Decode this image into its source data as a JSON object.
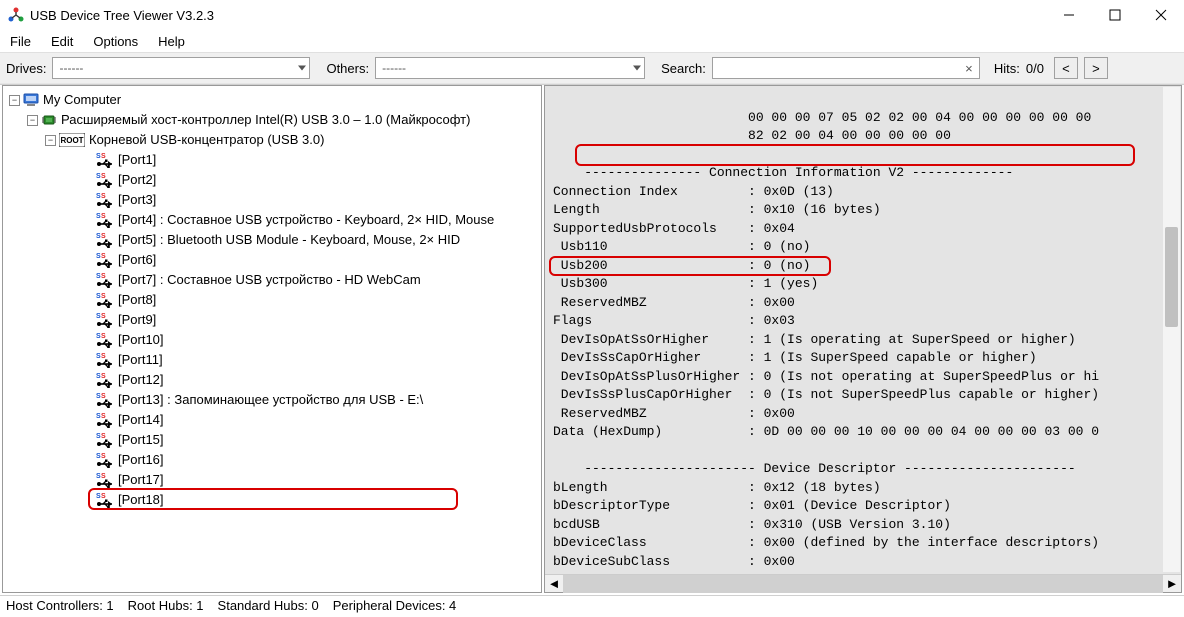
{
  "titlebar": {
    "title": "USB Device Tree Viewer V3.2.3"
  },
  "menu": {
    "file": "File",
    "edit": "Edit",
    "options": "Options",
    "help": "Help"
  },
  "toolbar": {
    "drives_label": "Drives:",
    "drives_value": "------",
    "others_label": "Others:",
    "others_value": "------",
    "search_label": "Search:",
    "hits_label": "Hits:",
    "hits_value": "0/0",
    "nav_prev": "<",
    "nav_next": ">",
    "clear_icon": "×"
  },
  "tree": {
    "root": "My Computer",
    "controller": "Расширяемый хост-контроллер Intel(R) USB 3.0 – 1.0 (Майкрософт)",
    "hub": "Корневой USB-концентратор (USB 3.0)",
    "root_badge": "ROOT",
    "ports": [
      {
        "label": "[Port1]",
        "desc": ""
      },
      {
        "label": "[Port2]",
        "desc": ""
      },
      {
        "label": "[Port3]",
        "desc": ""
      },
      {
        "label": "[Port4]",
        "desc": " : Составное USB устройство - Keyboard, 2× HID, Mouse"
      },
      {
        "label": "[Port5]",
        "desc": " : Bluetooth USB Module - Keyboard, Mouse, 2× HID"
      },
      {
        "label": "[Port6]",
        "desc": ""
      },
      {
        "label": "[Port7]",
        "desc": " : Составное USB устройство - HD WebCam"
      },
      {
        "label": "[Port8]",
        "desc": ""
      },
      {
        "label": "[Port9]",
        "desc": ""
      },
      {
        "label": "[Port10]",
        "desc": ""
      },
      {
        "label": "[Port11]",
        "desc": ""
      },
      {
        "label": "[Port12]",
        "desc": ""
      },
      {
        "label": "[Port13]",
        "desc": " : Запоминающее устройство для USB - E:\\"
      },
      {
        "label": "[Port14]",
        "desc": ""
      },
      {
        "label": "[Port15]",
        "desc": ""
      },
      {
        "label": "[Port16]",
        "desc": ""
      },
      {
        "label": "[Port17]",
        "desc": ""
      },
      {
        "label": "[Port18]",
        "desc": ""
      }
    ]
  },
  "details": {
    "l01": "                         00 00 00 07 05 02 02 00 04 00 00 00 00 00 00",
    "l02": "                         82 02 00 04 00 00 00 00 00",
    "l03": "",
    "l04": "    --------------- Connection Information V2 -------------",
    "l05": "Connection Index         : 0x0D (13)",
    "l06": "Length                   : 0x10 (16 bytes)",
    "l07": "SupportedUsbProtocols    : 0x04",
    "l08": " Usb110                  : 0 (no)",
    "l09": " Usb200                  : 0 (no)",
    "l10": " Usb300                  : 1 (yes)",
    "l11": " ReservedMBZ             : 0x00",
    "l12": "Flags                    : 0x03",
    "l13": " DevIsOpAtSsOrHigher     : 1 (Is operating at SuperSpeed or higher)",
    "l14": " DevIsSsCapOrHigher      : 1 (Is SuperSpeed capable or higher)",
    "l15": " DevIsOpAtSsPlusOrHigher : 0 (Is not operating at SuperSpeedPlus or hi",
    "l16": " DevIsSsPlusCapOrHigher  : 0 (Is not SuperSpeedPlus capable or higher)",
    "l17": " ReservedMBZ             : 0x00",
    "l18": "Data (HexDump)           : 0D 00 00 00 10 00 00 00 04 00 00 00 03 00 0",
    "l19": "",
    "l20": "    ---------------------- Device Descriptor ----------------------",
    "l21": "bLength                  : 0x12 (18 bytes)",
    "l22": "bDescriptorType          : 0x01 (Device Descriptor)",
    "l23": "bcdUSB                   : 0x310 (USB Version 3.10)",
    "l24": "bDeviceClass             : 0x00 (defined by the interface descriptors)",
    "l25": "bDeviceSubClass          : 0x00"
  },
  "status": {
    "host_controllers": "Host Controllers: 1",
    "root_hubs": "Root Hubs: 1",
    "standard_hubs": "Standard Hubs: 0",
    "peripheral": "Peripheral Devices: 4"
  }
}
